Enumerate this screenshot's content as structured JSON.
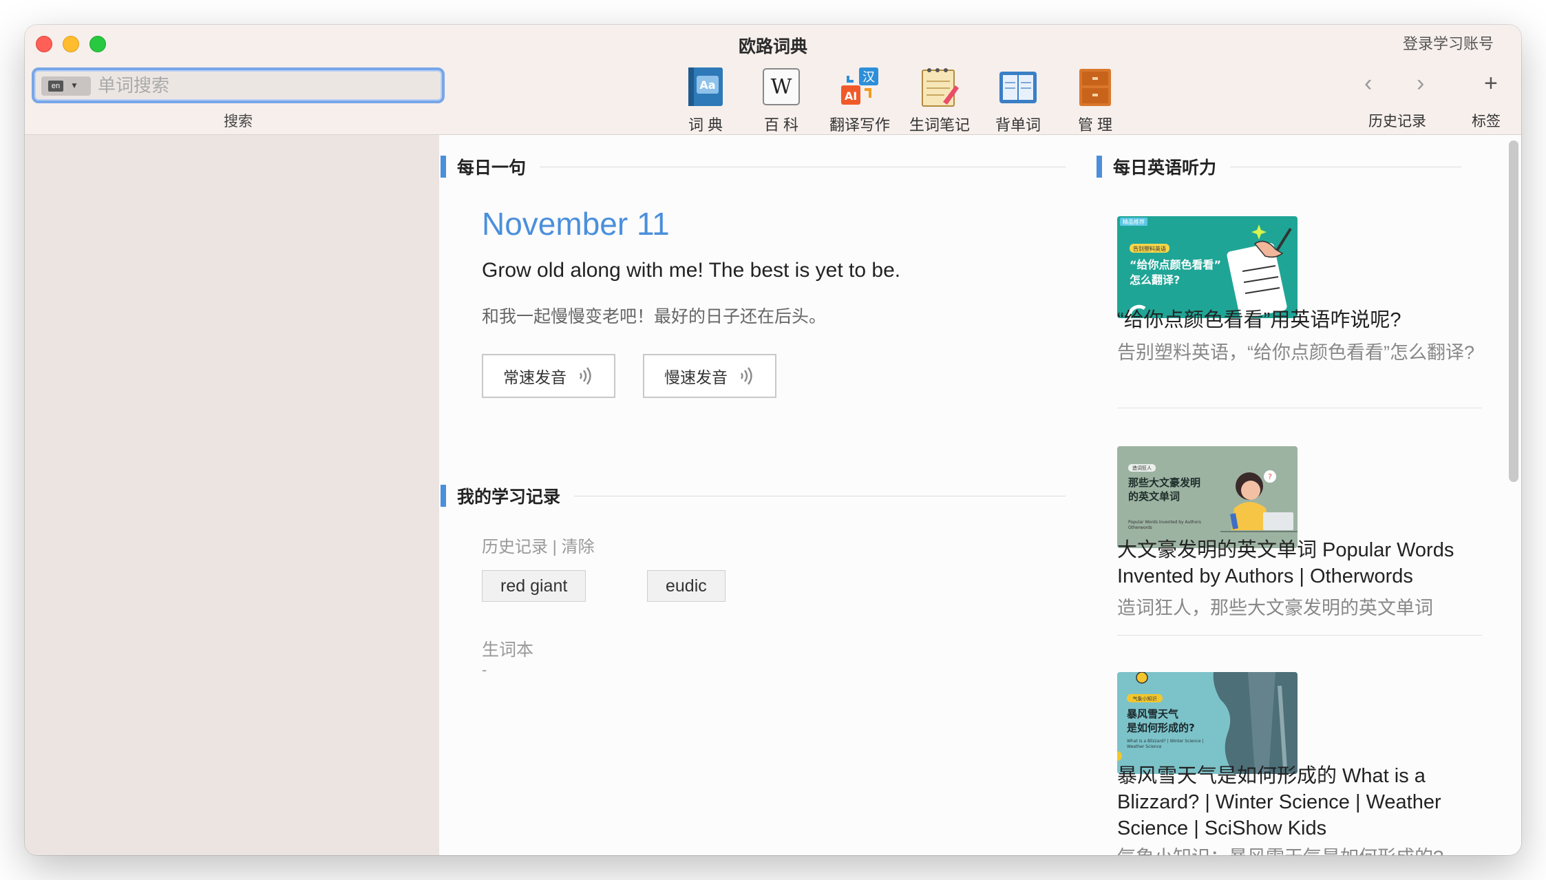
{
  "window": {
    "title": "欧路词典",
    "login_link": "登录学习账号"
  },
  "search": {
    "lang_tag": "en",
    "placeholder": "单词搜索",
    "label": "搜索"
  },
  "toolbar": {
    "items": [
      {
        "label": "词 典",
        "icon": "dictionary-icon"
      },
      {
        "label": "百 科",
        "icon": "wikipedia-icon"
      },
      {
        "label": "翻译写作",
        "icon": "translate-icon"
      },
      {
        "label": "生词笔记",
        "icon": "notes-icon"
      },
      {
        "label": "背单词",
        "icon": "flashcard-icon"
      },
      {
        "label": "管 理",
        "icon": "manage-icon"
      }
    ],
    "history_label": "历史记录",
    "tags_label": "标签"
  },
  "daily_sentence": {
    "section_title": "每日一句",
    "date": "November 11",
    "english": "Grow old along with me! The best is yet to be.",
    "chinese": "和我一起慢慢变老吧！最好的日子还在后头。",
    "normal_speed_label": "常速发音",
    "slow_speed_label": "慢速发音"
  },
  "study_record": {
    "section_title": "我的学习记录",
    "history_line": "历史记录 | 清除",
    "history_chips": [
      "red giant",
      "eudic"
    ],
    "vocab_label": "生词本",
    "vocab_empty": "-"
  },
  "listening": {
    "section_title": "每日英语听力",
    "cards": [
      {
        "title": "“给你点颜色看看”用英语咋说呢?",
        "subtitle": "告别塑料英语，“给你点颜色看看”怎么翻译?",
        "thumb_badge": "精品推荐",
        "thumb_tag": "告别塑料英语",
        "thumb_text": "“给你点颜色看看”怎么翻译?"
      },
      {
        "title": "大文豪发明的英文单词 Popular Words Invented by Authors | Otherwords",
        "subtitle": "造词狂人，那些大文豪发明的英文单词",
        "thumb_tag": "造词狂人",
        "thumb_text": "那些大文豪发明的英文单词",
        "thumb_small": "Popular Words Invented by Authors Otherwords"
      },
      {
        "title": "暴风雪天气是如何形成的 What is a Blizzard? | Winter Science | Weather Science | SciShow Kids",
        "subtitle": "气象小知识：暴风雪天气是如何形成的?",
        "thumb_tag": "气象小知识",
        "thumb_text": "暴风雪天气是如何形成的?",
        "thumb_small": "What is a Blizzard? | Winter Science | Weather Science"
      }
    ]
  },
  "colors": {
    "accent": "#4b8fdc",
    "titlebar": "#f6efec",
    "sidebar": "#ece4e1"
  }
}
